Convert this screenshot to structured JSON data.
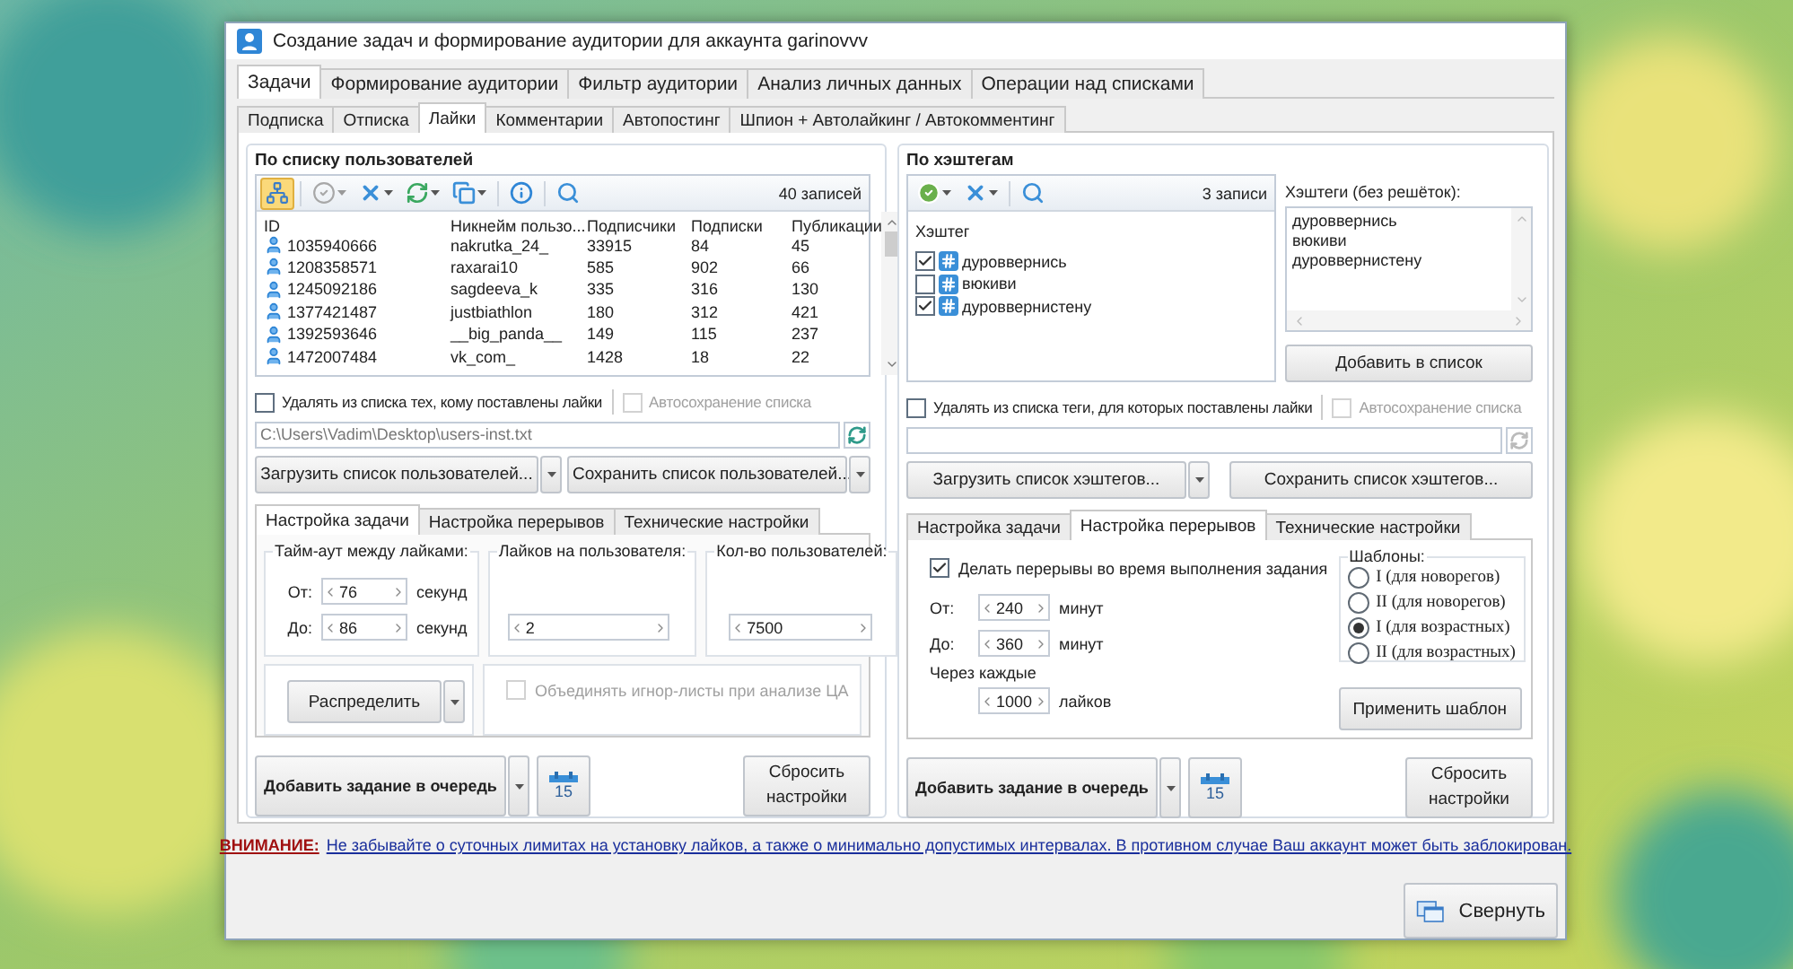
{
  "window": {
    "title": "Создание задач и формирование аудитории для аккаунта garinovvv"
  },
  "main_tabs": [
    {
      "label": "Задачи",
      "selected": true
    },
    {
      "label": "Формирование аудитории",
      "selected": false
    },
    {
      "label": "Фильтр аудитории",
      "selected": false
    },
    {
      "label": "Анализ личных данных",
      "selected": false
    },
    {
      "label": "Операции над списками",
      "selected": false
    }
  ],
  "sub_tabs": [
    {
      "label": "Подписка",
      "selected": false
    },
    {
      "label": "Отписка",
      "selected": false
    },
    {
      "label": "Лайки",
      "selected": true
    },
    {
      "label": "Комментарии",
      "selected": false
    },
    {
      "label": "Автопостинг",
      "selected": false
    },
    {
      "label": "Шпион + Автолайкинг / Автокомментинг",
      "selected": false
    }
  ],
  "users_panel": {
    "title": "По списку пользователей",
    "toggle_pressed": true,
    "count": "40 записей",
    "columns": [
      "ID",
      "Никнейм пользо...",
      "Подписчики",
      "Подписки",
      "Публикации"
    ],
    "rows": [
      [
        "1035940666",
        "nakrutka_24_",
        "33915",
        "84",
        "45"
      ],
      [
        "1208358571",
        "raxarai10",
        "585",
        "902",
        "66"
      ],
      [
        "1245092186",
        "sagdeeva_k",
        "335",
        "316",
        "130"
      ],
      [
        "1377421487",
        "justbiathlon",
        "180",
        "312",
        "421"
      ],
      [
        "1392593646",
        "__big_panda__",
        "149",
        "115",
        "237"
      ],
      [
        "1472007484",
        "vk_com_",
        "1428",
        "18",
        "22"
      ]
    ],
    "remove_option": {
      "label": "Удалять из списка тех, кому поставлены лайки",
      "checked": false,
      "disabled": false
    },
    "autosave": {
      "label": "Автосохранение списка",
      "checked": false,
      "disabled": true
    },
    "path": "C:\\Users\\Vadim\\Desktop\\users-inst.txt",
    "load_button": "Загрузить список пользователей...",
    "save_button": "Сохранить список пользователей...",
    "tabs": [
      {
        "label": "Настройка задачи",
        "selected": true
      },
      {
        "label": "Настройка перерывов",
        "selected": false
      },
      {
        "label": "Технические настройки",
        "selected": false
      }
    ],
    "timeout": {
      "title": "Тайм-аут между лайками:",
      "rows": [
        {
          "label": "От:",
          "value": "76",
          "unit": "секунд"
        },
        {
          "label": "До:",
          "value": "86",
          "unit": "секунд"
        }
      ]
    },
    "likes_per_user": {
      "title": "Лайков на пользователя:",
      "value": "2"
    },
    "user_count": {
      "title": "Кол-во пользователей:",
      "value": "7500"
    },
    "distribute_button": "Распределить",
    "merge_option": {
      "label": "Объединять игнор-листы при анализе ЦА",
      "checked": false,
      "disabled": true
    },
    "add_task_button": "Добавить задание в очередь",
    "calendar_day": "15",
    "reset_button": "Сбросить настройки"
  },
  "hashtags_panel": {
    "title": "По хэштегам",
    "count": "3 записи",
    "column": "Хэштег",
    "tags": [
      {
        "label": "дуроввернись",
        "checked": true
      },
      {
        "label": "вюкиви",
        "checked": false
      },
      {
        "label": "дуроввернистену",
        "checked": true
      }
    ],
    "input_label": "Хэштеги (без решёток):",
    "input_value": "дуроввернись\nвюкиви\nдуроввернистену",
    "add_button": "Добавить в список",
    "remove_option": {
      "label": "Удалять из списка теги, для которых поставлены лайки",
      "checked": false,
      "disabled": false
    },
    "autosave": {
      "label": "Автосохранение списка",
      "checked": false,
      "disabled": true
    },
    "load_button": "Загрузить список хэштегов...",
    "save_button": "Сохранить список хэштегов...",
    "tabs": [
      {
        "label": "Настройка задачи",
        "selected": false
      },
      {
        "label": "Настройка перерывов",
        "selected": true
      },
      {
        "label": "Технические настройки",
        "selected": false
      }
    ],
    "breaks_option": {
      "label": "Делать перерывы во время выполнения задания",
      "checked": true,
      "disabled": false
    },
    "break_rows": [
      {
        "label": "От:",
        "value": "240",
        "unit": "минут"
      },
      {
        "label": "До:",
        "value": "360",
        "unit": "минут"
      }
    ],
    "every_label": "Через каждые",
    "every_value": "1000",
    "every_unit": "лайков",
    "templates": {
      "title": "Шаблоны:",
      "options": [
        {
          "label": "I (для новорегов)",
          "selected": false
        },
        {
          "label": "II (для новорегов)",
          "selected": false
        },
        {
          "label": "I (для возрастных)",
          "selected": true
        },
        {
          "label": "II (для возрастных)",
          "selected": false
        }
      ]
    },
    "apply_button": "Применить шаблон",
    "add_task_button": "Добавить задание в очередь",
    "calendar_day": "15",
    "reset_button": "Сбросить настройки"
  },
  "warning": {
    "label": "ВНИМАНИЕ:",
    "text": "Не забывайте о суточных лимитах на установку лайков, а также о минимально допустимых интервалах. В противном случае Ваш аккаунт может быть заблокирован."
  },
  "collapse_button": "Свернуть"
}
